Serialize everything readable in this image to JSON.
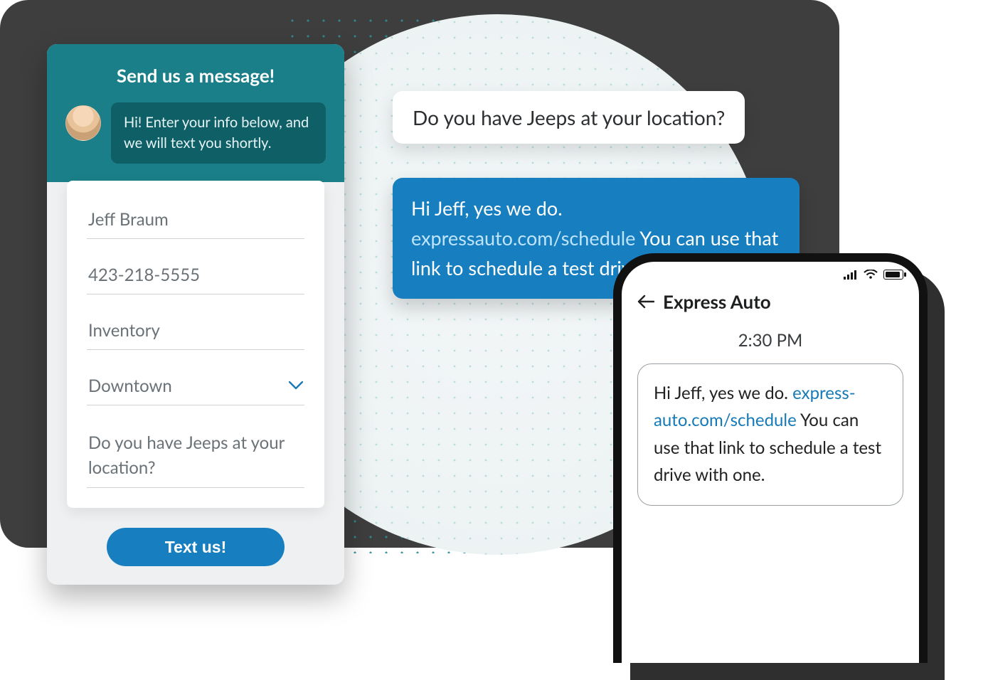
{
  "widget": {
    "title": "Send us a message!",
    "greeting": "Hi! Enter your info below, and we will text you shortly.",
    "fields": {
      "name": "Jeff Braum",
      "phone": "423-218-5555",
      "topic": "Inventory",
      "location": "Downtown",
      "message": "Do you have Jeeps at your location?"
    },
    "button": "Text us!"
  },
  "chat": {
    "customer": "Do you have Jeeps at your location?",
    "reply_lead": "Hi Jeff, yes we do. ",
    "reply_link": "expressauto.com/schedule",
    "reply_tail": " You can use that link to schedule a test drive with one."
  },
  "phone": {
    "thread_title": "Express Auto",
    "time": "2:30 PM",
    "msg_lead": "Hi Jeff, yes we do. ",
    "msg_link": "express-auto.com/schedule",
    "msg_tail": " You can use that link to schedule a test drive with one."
  }
}
